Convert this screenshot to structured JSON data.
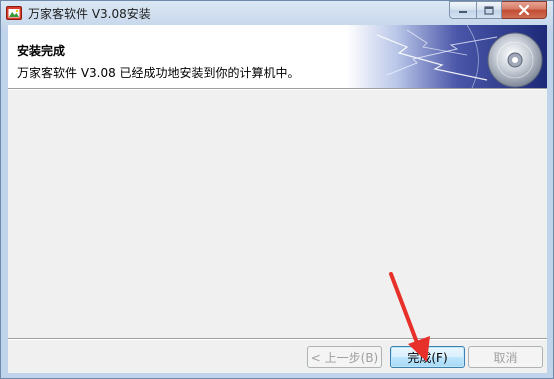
{
  "window": {
    "title": "万家客软件 V3.08安装",
    "icon": "installer-app-icon"
  },
  "controls": {
    "minimize": "minimize-icon",
    "maximize": "maximize-icon",
    "close": "close-icon"
  },
  "header": {
    "title": "安装完成",
    "subtitle": "万家客软件 V3.08 已经成功地安装到你的计算机中。",
    "banner_image": "cd-disc-lightning-banner"
  },
  "buttons": {
    "back": "< 上一步(B)",
    "finish": "完成(F)",
    "cancel": "取消"
  },
  "annotation": {
    "arrow_color": "#e8302a",
    "points_to": "finish-button"
  }
}
